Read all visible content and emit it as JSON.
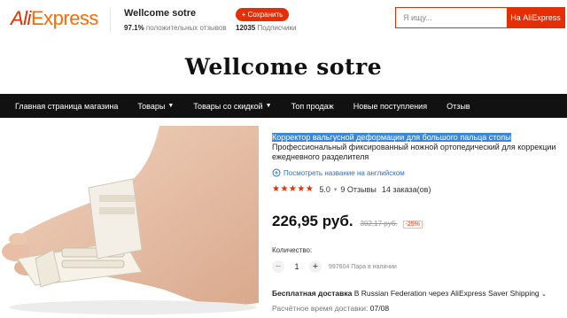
{
  "header": {
    "logo_ali": "Ali",
    "logo_express": "Express",
    "store_name": "Wellcome sotre",
    "positive_pct": "97.1%",
    "positive_label": "положительных отзывов",
    "save_button": "+ Сохранить",
    "subscribers_count": "12035",
    "subscribers_label": "Подписчики",
    "search_placeholder": "Я ищу...",
    "search_button": "На AliExpress"
  },
  "banner": {
    "title": "Wellcome sotre"
  },
  "nav": {
    "items": [
      {
        "label": "Главная страница магазина"
      },
      {
        "label": "Товары",
        "dropdown": true
      },
      {
        "label": "Товары со скидкой",
        "dropdown": true
      },
      {
        "label": "Топ продаж"
      },
      {
        "label": "Новые поступления"
      },
      {
        "label": "Отзыв"
      }
    ]
  },
  "product": {
    "title_highlight": "Корректор вальгусной деформации для большого пальца стопы",
    "title_rest": " Профессиональный фиксированный ножной ортопедический для коррекции ежедневного разделителя",
    "translate_link": "Посмотреть название на английском",
    "rating_value": "5.0",
    "reviews": "9 Отзывы",
    "orders": "14 заказа(ов)",
    "price": "226,95 руб.",
    "old_price": "302,17 руб.",
    "discount": "-25%",
    "quantity_label": "Количество:",
    "quantity_value": "1",
    "stock": "997604 Пара в наличии",
    "shipping_free": "Бесплатная доставка",
    "shipping_rest": " В Russian Federation через AliExpress Saver Shipping",
    "eta_label": "Расчётное время доставки:",
    "eta_date": "07/08"
  },
  "colors": {
    "accent": "#e62e04",
    "nav_bg": "#111111",
    "highlight": "#3e86d6",
    "link": "#2e6fbd"
  },
  "icons": [
    "chevron-down-icon",
    "star-icon",
    "translate-icon",
    "minus-icon",
    "plus-icon"
  ]
}
